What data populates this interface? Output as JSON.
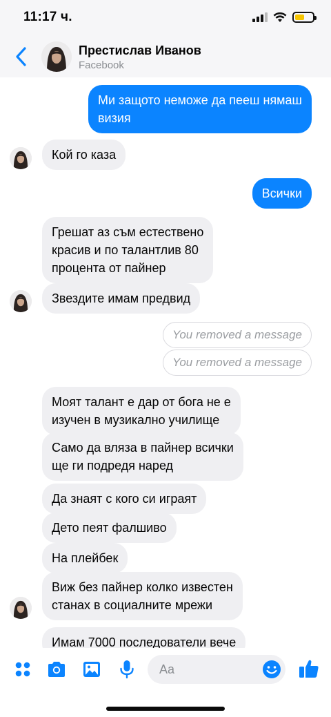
{
  "status_bar": {
    "time": "11:17 ч.",
    "battery_color": "#f5c400"
  },
  "header": {
    "name": "Престислав Иванов",
    "subtitle": "Facebook"
  },
  "colors": {
    "accent": "#0b84ff",
    "incoming_bubble": "#efeff2",
    "header_bg": "#f6f6f8"
  },
  "messages": [
    {
      "direction": "out",
      "text": "Ми защото неможе да пееш нямаш\nвизия"
    },
    {
      "direction": "in",
      "text": "Кой го каза"
    },
    {
      "direction": "out",
      "text": "Всички"
    },
    {
      "direction": "in",
      "text": "Грешат аз съм естествено\nкрасив и по талантлив 80\nпроцента от пайнер"
    },
    {
      "direction": "in",
      "text": "Звездите имам предвид"
    },
    {
      "direction": "removed",
      "text": "You removed a message"
    },
    {
      "direction": "removed",
      "text": "You removed a message"
    },
    {
      "direction": "in",
      "text": "Моят талант е дар от бога не е\nизучен в музикално училище"
    },
    {
      "direction": "in",
      "text": "Само да вляза в пайнер всички\nще ги подредя наред"
    },
    {
      "direction": "in",
      "text": "Да знаят с кого си играят"
    },
    {
      "direction": "in",
      "text": "Дето пеят фалшиво"
    },
    {
      "direction": "in",
      "text": "На плейбек"
    },
    {
      "direction": "in",
      "text": "Виж без пайнер колко известен\nстанах в социалните мрежи"
    },
    {
      "direction": "in",
      "text": "Имам 7000 последователи вече"
    }
  ],
  "composer": {
    "placeholder": "Aa",
    "icons": [
      "apps-icon",
      "camera-icon",
      "image-icon",
      "microphone-icon",
      "emoji-icon",
      "thumbs-up-icon"
    ]
  }
}
